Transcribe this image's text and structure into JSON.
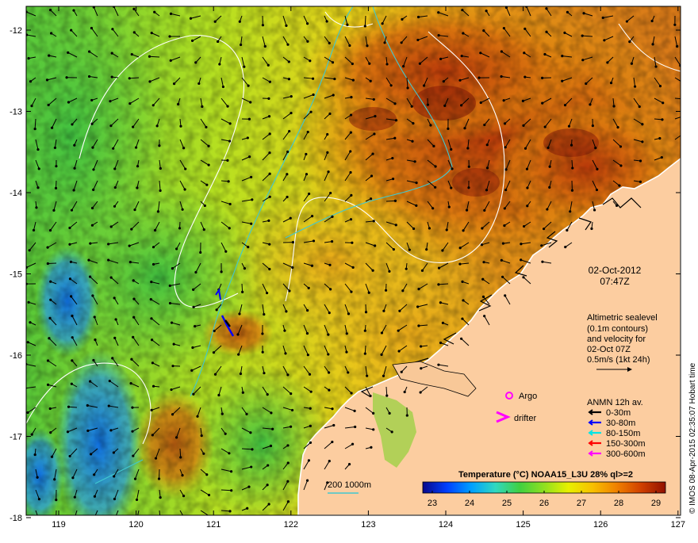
{
  "map": {
    "axes": {
      "x_ticks": [
        "119",
        "120",
        "121",
        "122",
        "123",
        "124",
        "125",
        "126",
        "127"
      ],
      "y_ticks": [
        "-12",
        "-13",
        "-14",
        "-15",
        "-16",
        "-17",
        "-18"
      ]
    },
    "date": "02-Oct-2012",
    "time": "07:47Z",
    "velocity_note": {
      "line1": "Altimetric sealevel",
      "line2": "(0.1m contours)",
      "line3": "and velocity for",
      "line4": "02-Oct 07Z",
      "line5": "0.5m/s (1kt 24h)"
    },
    "markers": {
      "argo_label": "Argo",
      "drifter_label": "drifter",
      "argo_color": "#ff00ff",
      "drifter_color": "#ff00ff"
    },
    "anmn": {
      "title": "ANMN 12h av.",
      "items": [
        {
          "label": "0-30m",
          "color": "#000000"
        },
        {
          "label": "30-80m",
          "color": "#0000ff"
        },
        {
          "label": "80-150m",
          "color": "#00e5e5"
        },
        {
          "label": "150-300m",
          "color": "#ff0000"
        },
        {
          "label": "300-600m",
          "color": "#ff00ff"
        }
      ]
    },
    "depth_legend": {
      "label": "200  1000m",
      "color": "#40c8d0"
    },
    "colorbar": {
      "title": "Temperature (°C) NOAA15_L3U 28% ql>=2",
      "ticks": [
        "23",
        "24",
        "25",
        "26",
        "27",
        "28",
        "29"
      ],
      "colors": [
        "#08088a",
        "#0040ff",
        "#00a0ff",
        "#30d8c0",
        "#40d040",
        "#90e020",
        "#e8f000",
        "#f8c000",
        "#f08000",
        "#d04000",
        "#901000"
      ]
    },
    "credit": "© IMOS 08-Apr-2015 02:35:07 Hobart time",
    "colors": {
      "land": "#fccda0",
      "coast": "#ffffff",
      "contour": "#ffffff",
      "isobath": "#40c8d0"
    }
  }
}
